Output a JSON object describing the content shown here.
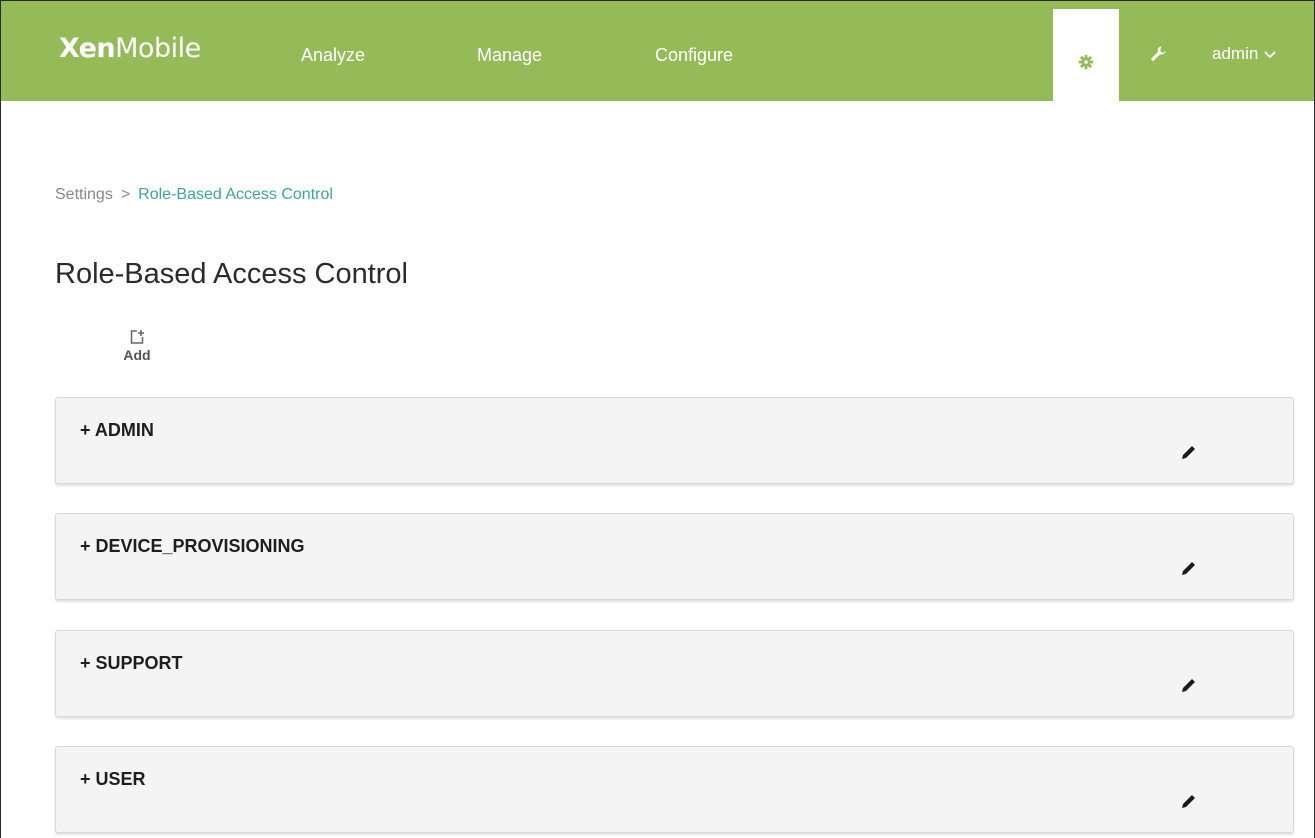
{
  "header": {
    "logo_bold": "Xen",
    "logo_light": "Mobile",
    "nav": [
      "Analyze",
      "Manage",
      "Configure"
    ],
    "user_label": "admin"
  },
  "breadcrumb": {
    "parent": "Settings",
    "separator": ">",
    "current": "Role-Based Access Control"
  },
  "page": {
    "title": "Role-Based Access Control",
    "add_label": "Add"
  },
  "roles": [
    {
      "label": "+ ADMIN"
    },
    {
      "label": "+ DEVICE_PROVISIONING"
    },
    {
      "label": "+ SUPPORT"
    },
    {
      "label": "+ USER"
    }
  ],
  "colors": {
    "header_bg": "#95bb58",
    "link_accent": "#3ca5a0",
    "row_bg": "#f4f4f4"
  },
  "icons": {
    "settings": "gear-icon",
    "tools": "wrench-icon",
    "user_menu": "chevron-down-icon",
    "add": "add-document-icon",
    "row_action": "pencil-icon"
  }
}
